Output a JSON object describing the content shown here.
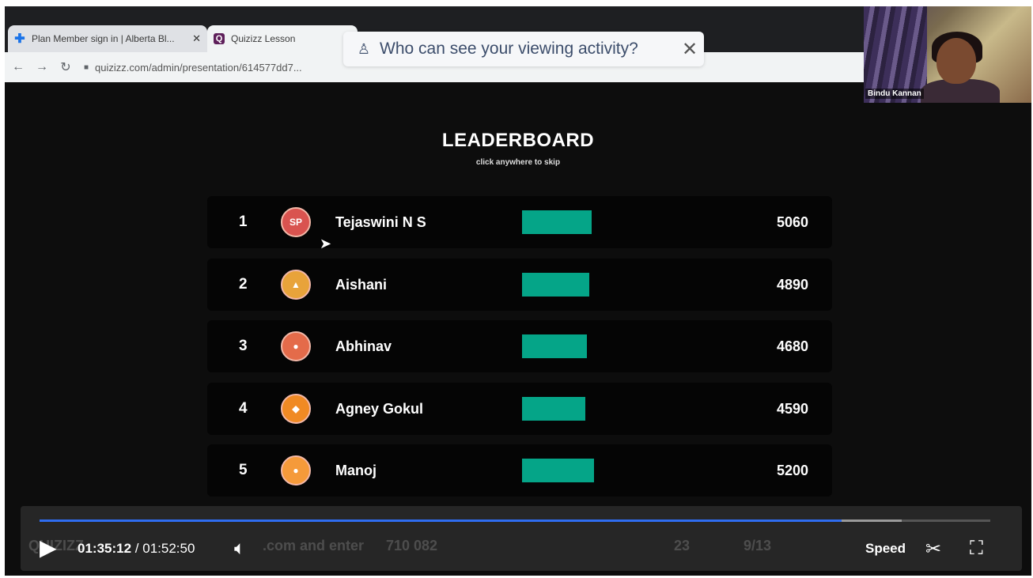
{
  "browser": {
    "tabs": [
      {
        "label": "Plan Member sign in | Alberta Bl...",
        "icon": "plus-cross-icon",
        "active": false
      },
      {
        "label": "Quizizz Lesson",
        "icon": "quizizz-q-icon",
        "active": true
      }
    ],
    "url": "quizizz.com/admin/presentation/614577dd7..."
  },
  "privacy_popup": {
    "text": "Who can see your viewing activity?",
    "icon": "person-eye-icon"
  },
  "webcam": {
    "name": "Bindu Kannan"
  },
  "leaderboard": {
    "title": "LEADERBOARD",
    "subtitle": "click anywhere to skip",
    "accent_color": "#05a588",
    "rows": [
      {
        "rank": "1",
        "name": "Tejaswini N S",
        "score": "5060",
        "bar_fraction": 1.0,
        "avatar_color": "#d9534f"
      },
      {
        "rank": "2",
        "name": "Aishani",
        "score": "4890",
        "bar_fraction": 0.97,
        "avatar_color": "#e8a33a"
      },
      {
        "rank": "3",
        "name": "Abhinav",
        "score": "4680",
        "bar_fraction": 0.93,
        "avatar_color": "#e46b4a"
      },
      {
        "rank": "4",
        "name": "Agney Gokul",
        "score": "4590",
        "bar_fraction": 0.91,
        "avatar_color": "#f08a24"
      },
      {
        "rank": "5",
        "name": "Manoj",
        "score": "5200",
        "bar_fraction": 1.03,
        "avatar_color": "#f59a3a"
      }
    ]
  },
  "player": {
    "current_time": "01:35:12",
    "separator": "/",
    "total_time": "01:52:50",
    "speed_label": "Speed",
    "progress_fraction": 0.844,
    "buffer_fraction": 0.907,
    "behind_text": {
      "brand": "QUIZIZZ",
      "join": ".com and enter",
      "code": "710 082",
      "players": "23",
      "slides": "9/13"
    }
  }
}
